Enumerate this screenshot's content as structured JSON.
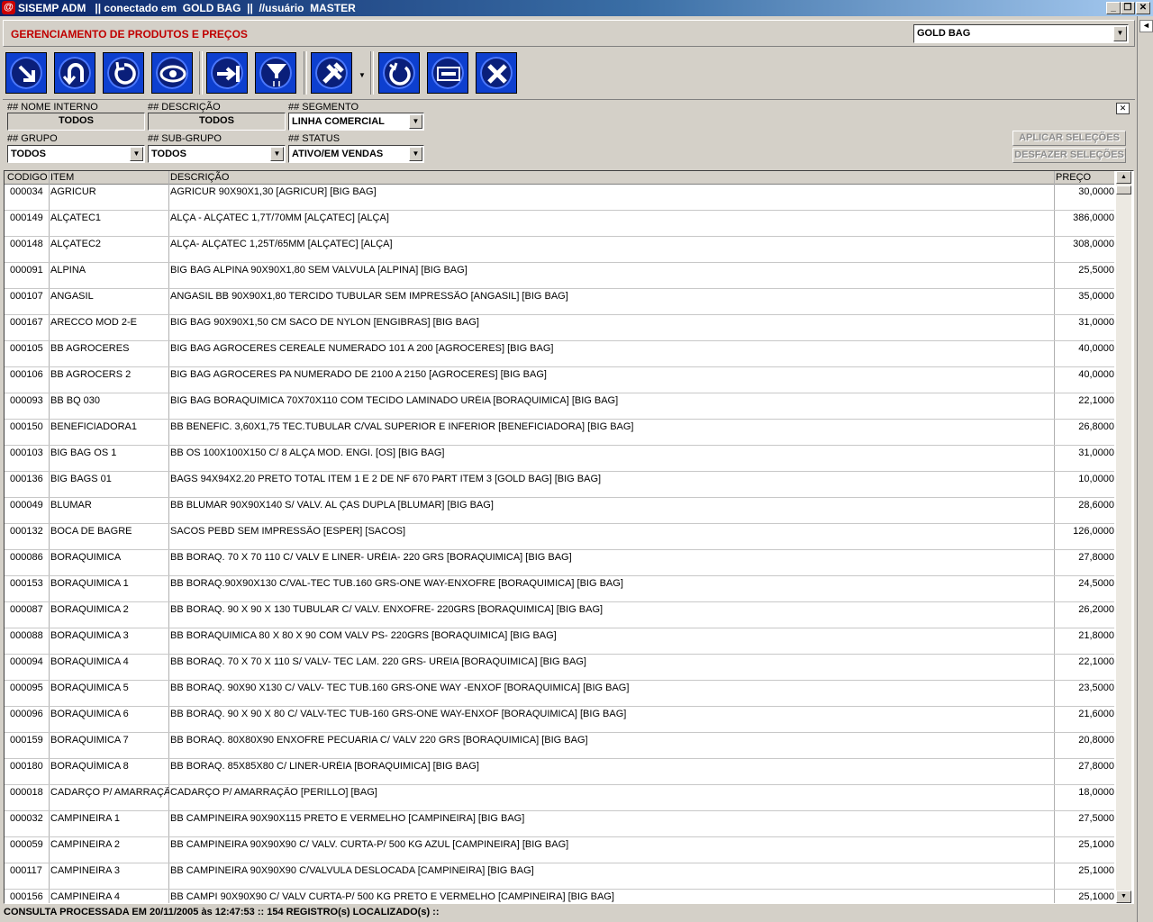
{
  "window": {
    "title": "SISEMP ADM   || conectado em  GOLD BAG  ||  //usuário  MASTER",
    "minimize": "_",
    "restore": "❐",
    "close": "✕",
    "back": "◄"
  },
  "header": {
    "page_title": "GERENCIAMENTO DE PRODUTOS E PREÇOS",
    "company_select": "GOLD BAG"
  },
  "toolbar": {
    "buttons": [
      "enter-icon",
      "undo-icon",
      "refresh-icon",
      "view-icon",
      "next-icon",
      "filter-icon",
      "tools-icon",
      "reload-icon",
      "print-icon",
      "close-icon"
    ],
    "accent": "#0d3fcf"
  },
  "filters": {
    "nome_interno_label": "## NOME INTERNO",
    "nome_interno_value": "TODOS",
    "descricao_label": "## DESCRIÇÃO",
    "descricao_value": "TODOS",
    "segmento_label": "## SEGMENTO",
    "segmento_value": "LINHA COMERCIAL",
    "grupo_label": "## GRUPO",
    "grupo_value": "TODOS",
    "subgrupo_label": "## SUB-GRUPO",
    "subgrupo_value": "TODOS",
    "status_label": "## STATUS",
    "status_value": "ATIVO/EM VENDAS",
    "apply_label": "APLICAR SELEÇÕES",
    "undo_label": "DESFAZER SELEÇÕES"
  },
  "table": {
    "columns": [
      "CODIGO",
      "ITEM",
      "DESCRIÇÃO",
      "PREÇO"
    ],
    "rows": [
      [
        "000034",
        "AGRICUR",
        "AGRICUR 90X90X1,30   [AGRICUR] [BIG BAG]",
        "30,0000"
      ],
      [
        "000149",
        "ALÇATEC1",
        "ALÇA - ALÇATEC 1,7T/70MM   [ALÇATEC] [ALÇA]",
        "386,0000"
      ],
      [
        "000148",
        "ALÇATEC2",
        "ALÇA- ALÇATEC 1,25T/65MM   [ALÇATEC] [ALÇA]",
        "308,0000"
      ],
      [
        "000091",
        "ALPINA",
        "BIG BAG ALPINA 90X90X1,80 SEM VALVULA   [ALPINA] [BIG BAG]",
        "25,5000"
      ],
      [
        "000107",
        "ANGASIL",
        "ANGASIL BB 90X90X1,80 TERCIDO TUBULAR SEM IMPRESSÃO   [ANGASIL] [BIG BAG]",
        "35,0000"
      ],
      [
        "000167",
        "ARECCO MOD 2-E",
        "BIG BAG 90X90X1,50 CM SACO DE NYLON   [ENGIBRAS] [BIG BAG]",
        "31,0000"
      ],
      [
        "000105",
        "BB AGROCERES",
        "BIG BAG AGROCERES  CEREALE NUMERADO 101 A 200   [AGROCERES] [BIG BAG]",
        "40,0000"
      ],
      [
        "000106",
        "BB AGROCERS 2",
        "BIG BAG AGROCERES PA NUMERADO DE 2100 A 2150   [AGROCERES] [BIG BAG]",
        "40,0000"
      ],
      [
        "000093",
        "BB BQ 030",
        "BIG BAG BORAQUIMICA 70X70X110 COM TECIDO LAMINADO URÉIA   [BORAQUIMICA] [BIG BAG]",
        "22,1000"
      ],
      [
        "000150",
        "BENEFICIADORA1",
        "BB BENEFIC. 3,60X1,75 TEC.TUBULAR C/VAL SUPERIOR E INFERIOR   [BENEFICIADORA] [BIG BAG]",
        "26,8000"
      ],
      [
        "000103",
        "BIG BAG  OS 1",
        "BB OS 100X100X150 C/ 8 ALÇA MOD. ENGI.   [OS] [BIG BAG]",
        "31,0000"
      ],
      [
        "000136",
        "BIG BAGS 01",
        "BAGS 94X94X2.20 PRETO TOTAL ITEM 1 E 2 DE NF 670 PART ITEM 3   [GOLD BAG] [BIG BAG]",
        "10,0000"
      ],
      [
        "000049",
        "BLUMAR",
        "BB  BLUMAR 90X90X140 S/ VALV. AL ÇAS DUPLA   [BLUMAR] [BIG BAG]",
        "28,6000"
      ],
      [
        "000132",
        "BOCA DE BAGRE",
        "SACOS PEBD SEM IMPRESSÃO   [ESPER] [SACOS]",
        "126,0000"
      ],
      [
        "000086",
        "BORAQUIMICA",
        "BB BORAQ. 70 X 70 110 C/ VALV E LINER- URÉIA- 220 GRS   [BORAQUIMICA] [BIG BAG]",
        "27,8000"
      ],
      [
        "000153",
        "BORAQUIMICA 1",
        "BB BORAQ.90X90X130 C/VAL-TEC TUB.160 GRS-ONE WAY-ENXOFRE   [BORAQUIMICA] [BIG BAG]",
        "24,5000"
      ],
      [
        "000087",
        "BORAQUIMICA 2",
        "BB BORAQ. 90 X 90 X 130 TUBULAR C/ VALV. ENXOFRE- 220GRS   [BORAQUIMICA] [BIG BAG]",
        "26,2000"
      ],
      [
        "000088",
        "BORAQUIMICA 3",
        "BB BORAQUIMICA 80 X 80 X 90  COM VALV PS- 220GRS   [BORAQUIMICA] [BIG BAG]",
        "21,8000"
      ],
      [
        "000094",
        "BORAQUIMICA 4",
        "BB BORAQ. 70 X 70 X 110 S/ VALV- TEC LAM. 220 GRS- UREIA   [BORAQUIMICA] [BIG BAG]",
        "22,1000"
      ],
      [
        "000095",
        "BORAQUIMICA 5",
        "BB BORAQ. 90X90 X130 C/ VALV- TEC TUB.160 GRS-ONE WAY -ENXOF   [BORAQUIMICA] [BIG BAG]",
        "23,5000"
      ],
      [
        "000096",
        "BORAQUIMICA 6",
        "BB BORAQ. 90 X 90 X 80 C/ VALV-TEC TUB-160 GRS-ONE WAY-ENXOF   [BORAQUIMICA] [BIG BAG]",
        "21,6000"
      ],
      [
        "000159",
        "BORAQUIMICA 7",
        "BB BORAQ. 80X80X90 ENXOFRE PECUARIA C/ VALV 220 GRS   [BORAQUIMICA] [BIG BAG]",
        "20,8000"
      ],
      [
        "000180",
        "BORAQUÍMICA 8",
        "BB BORAQ. 85X85X80 C/ LINER-URÉIA   [BORAQUIMICA] [BIG BAG]",
        "27,8000"
      ],
      [
        "000018",
        "CADARÇO P/ AMARRAÇÃO",
        "CADARÇO P/ AMARRAÇÃO   [PERILLO] [BAG]",
        "18,0000"
      ],
      [
        "000032",
        "CAMPINEIRA 1",
        "BB CAMPINEIRA 90X90X115  PRETO E VERMELHO   [CAMPINEIRA] [BIG BAG]",
        "27,5000"
      ],
      [
        "000059",
        "CAMPINEIRA 2",
        "BB CAMPINEIRA 90X90X90  C/ VALV. CURTA-P/ 500 KG AZUL   [CAMPINEIRA] [BIG BAG]",
        "25,1000"
      ],
      [
        "000117",
        "CAMPINEIRA 3",
        "BB CAMPINEIRA 90X90X90 C/VALVULA DESLOCADA   [CAMPINEIRA] [BIG BAG]",
        "25,1000"
      ],
      [
        "000156",
        "CAMPINEIRA 4",
        "BB CAMPI 90X90X90 C/ VALV CURTA-P/ 500 KG PRETO E VERMELHO   [CAMPINEIRA] [BIG BAG]",
        "25,1000"
      ]
    ]
  },
  "status": {
    "text": "CONSULTA PROCESSADA EM 20/11/2005 às 12:47:53 :: 154 REGISTRO(s) LOCALIZADO(s) ::"
  }
}
